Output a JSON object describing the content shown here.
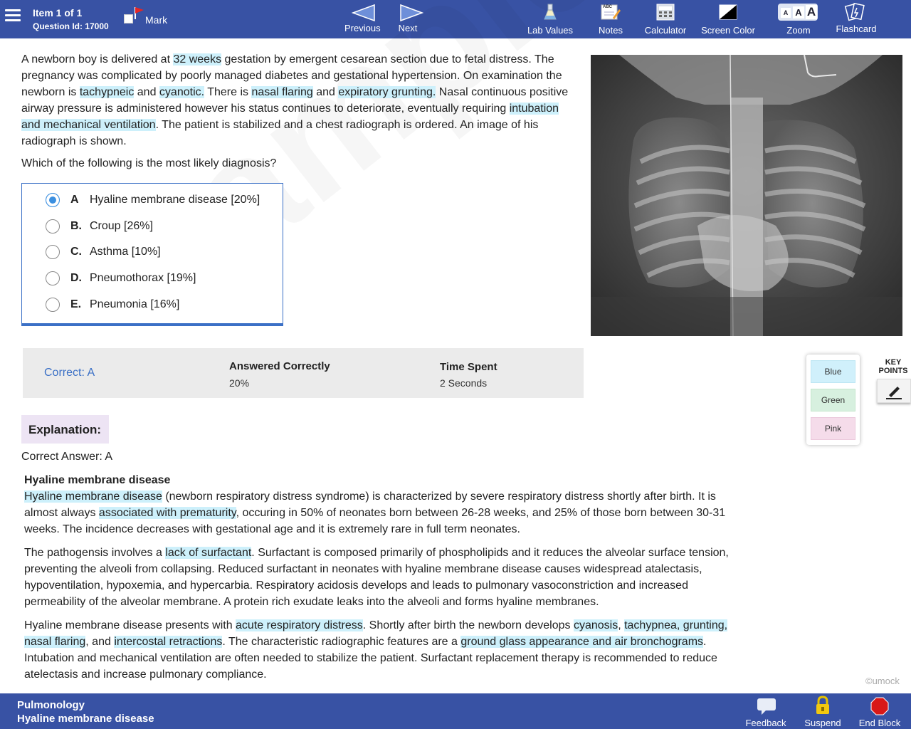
{
  "header": {
    "item_label": "Item 1 of 1",
    "question_id": "Question Id: 17000",
    "mark_label": "Mark",
    "previous_label": "Previous",
    "next_label": "Next",
    "lab_values_label": "Lab Values",
    "notes_label": "Notes",
    "calculator_label": "Calculator",
    "screen_color_label": "Screen Color",
    "zoom_label": "Zoom",
    "flashcard_label": "Flashcard",
    "notes_icon_text": "ABC",
    "zoom_letters": [
      "A",
      "A",
      "A"
    ]
  },
  "stem": {
    "p1": "A newborn boy is delivered at ",
    "h1": "32 weeks",
    "p2": " gestation by emergent cesarean section due to fetal distress. The pregnancy was complicated by poorly managed diabetes and gestational hypertension. On examination the newborn is ",
    "h2": "tachypneic",
    "p3": " and ",
    "h3": "cyanotic.",
    "p4": " There is ",
    "h4": "nasal flaring",
    "p5": " and ",
    "h5": "expiratory grunting.",
    "p6": " Nasal continuous positive airway pressure is administered however his status continues to deteriorate, eventually requiring ",
    "h6": "intubation and mechanical ventilation",
    "p7": ". The patient is stabilized and a chest radiograph is ordered. An image of his radiograph is shown.",
    "question": "Which of the following is the most likely diagnosis?"
  },
  "answers": [
    {
      "letter": "A",
      "text": "Hyaline membrane disease",
      "pct": "[20%]",
      "selected": true
    },
    {
      "letter": "B.",
      "text": "Croup",
      "pct": "[26%]",
      "selected": false
    },
    {
      "letter": "C.",
      "text": "Asthma",
      "pct": "[10%]",
      "selected": false
    },
    {
      "letter": "D.",
      "text": "Pneumothorax",
      "pct": "[19%]",
      "selected": false
    },
    {
      "letter": "E.",
      "text": "Pneumonia",
      "pct": "[16%]",
      "selected": false
    }
  ],
  "stats": {
    "correct_label": "Correct: A",
    "answered_title": "Answered Correctly",
    "answered_value": "20%",
    "time_title": "Time Spent",
    "time_value": "2 Seconds"
  },
  "highlighter": {
    "blue": "Blue",
    "green": "Green",
    "pink": "Pink",
    "key_points_1": "KEY",
    "key_points_2": "POINTS"
  },
  "watermark": "Sample",
  "explanation": {
    "tab_label": "Explanation:",
    "correct_answer": "Correct Answer: A",
    "heading": "Hyaline membrane disease",
    "para1": {
      "h1": "Hyaline membrane disease",
      "t1": " (newborn respiratory distress syndrome) is characterized by severe respiratory distress shortly after birth. It is almost always ",
      "h2": "associated with prematurity",
      "t2": ", occuring in 50% of neonates born between 26-28 weeks, and 25% of those born between 30-31 weeks. The incidence decreases with gestational age and it is extremely rare in full term neonates."
    },
    "para2": {
      "t1": "The pathogensis involves a ",
      "h1": "lack of surfactant",
      "t2": ". Surfactant is composed primarily of phospholipids and it reduces the alveolar surface tension, preventing the alveoli from collapsing. Reduced surfactant in neonates with hyaline membrane disease causes widespread atalectasis, hypoventilation, hypoxemia, and hypercarbia. Respiratory acidosis develops and leads to pulmonary vasoconstriction and increased permeability of the alveolar membrane. A protein rich exudate leaks into the alveoli and forms hyaline membranes."
    },
    "para3": {
      "t1": "Hyaline membrane disease presents with ",
      "h1": "acute respiratory distress",
      "t2": ". Shortly after birth the newborn develops ",
      "h2": "cyanosis",
      "t3": ", ",
      "h3": "tachypnea, grunting, nasal flaring",
      "t4": ", and ",
      "h4": "intercostal retractions",
      "t5": ". The characteristic radiographic features are a ",
      "h5": "ground glass appearance and air bronchograms",
      "t6": ". Intubation and mechanical ventilation are often needed to stabilize the patient. Surfactant replacement therapy is recommended to reduce atelectasis and increase pulmonary compliance."
    }
  },
  "copyright": "©umock",
  "footer": {
    "category": "Pulmonology",
    "topic": "Hyaline membrane disease",
    "feedback_label": "Feedback",
    "suspend_label": "Suspend",
    "end_block_label": "End Block"
  },
  "colors": {
    "header_bg": "#3852a4",
    "highlight": "#cdf0fb",
    "correct_text": "#3b70c6",
    "answer_border": "#3b70c6"
  }
}
